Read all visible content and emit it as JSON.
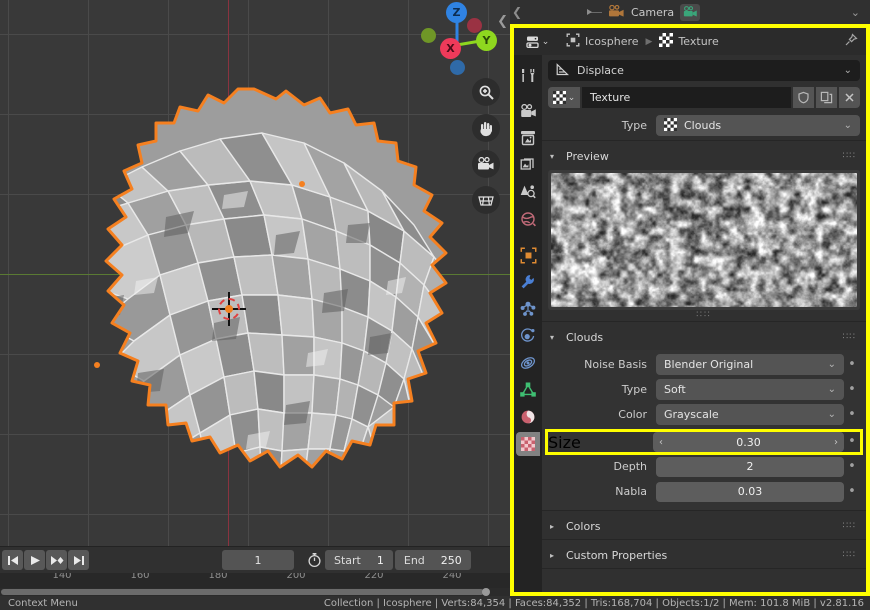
{
  "outliner": {
    "back_icon": "chevron-left-icon",
    "camera_label": "Camera",
    "camera_icon": "camera-icon",
    "camera_data_icon": "camera-data-icon",
    "collapse_icon": "chevron-down-icon"
  },
  "viewport": {
    "gizmo": {
      "x_label": "X",
      "y_label": "Y",
      "z_label": "Z",
      "x_color": "#ee3a5a",
      "y_color": "#8ed71f",
      "z_color": "#2f83e3"
    },
    "tools": [
      {
        "name": "zoom-icon",
        "title": "Zoom"
      },
      {
        "name": "hand-icon",
        "title": "Move View"
      },
      {
        "name": "camera-icon",
        "title": "Camera View"
      },
      {
        "name": "grid-icon",
        "title": "Toggle Orthographic"
      }
    ],
    "selection_outline_color": "#f58020",
    "background_color": "#393939",
    "cursor_icon": "3d-cursor-icon"
  },
  "timeline": {
    "playback": [
      {
        "name": "jump-start-button",
        "glyph": "◀❘"
      },
      {
        "name": "play-button",
        "glyph": "▶"
      },
      {
        "name": "next-keyframe-button",
        "glyph": "▶◆"
      },
      {
        "name": "jump-end-button",
        "glyph": "❘▶"
      }
    ],
    "current_frame": "1",
    "clock_icon": "stopwatch-icon",
    "start_label": "Start",
    "start_value": "1",
    "end_label": "End",
    "end_value": "250",
    "ruler_ticks": [
      "140",
      "160",
      "180",
      "200",
      "220",
      "240"
    ]
  },
  "properties": {
    "editor_type_icon": "properties-editor-icon",
    "breadcrumb": [
      {
        "icon": "object-icon",
        "label": "Icosphere"
      },
      {
        "icon": "texture-icon",
        "label": "Texture"
      }
    ],
    "pin_icon": "pin-icon",
    "tabs": [
      {
        "name": "tab-tool",
        "icon": "tool-icon",
        "active": false
      },
      {
        "name": "tab-render",
        "icon": "render-camera-icon",
        "active": false
      },
      {
        "name": "tab-output",
        "icon": "printer-icon",
        "active": false
      },
      {
        "name": "tab-view-layer",
        "icon": "images-icon",
        "active": false
      },
      {
        "name": "tab-scene",
        "icon": "scene-cone-icon",
        "active": false
      },
      {
        "name": "tab-world",
        "icon": "world-globe-icon",
        "active": false
      },
      {
        "name": "tab-object",
        "icon": "object-square-icon",
        "active": false
      },
      {
        "name": "tab-modifiers",
        "icon": "wrench-icon",
        "active": false
      },
      {
        "name": "tab-particles",
        "icon": "particles-icon",
        "active": false
      },
      {
        "name": "tab-physics",
        "icon": "physics-orbit-icon",
        "active": false
      },
      {
        "name": "tab-constraints",
        "icon": "constraint-icon",
        "active": false
      },
      {
        "name": "tab-data",
        "icon": "mesh-data-icon",
        "active": false
      },
      {
        "name": "tab-material",
        "icon": "material-sphere-icon",
        "active": false
      },
      {
        "name": "tab-texture",
        "icon": "texture-checker-icon",
        "active": true
      }
    ],
    "modifier_context": {
      "icon": "displace-modifier-icon",
      "label": "Displace",
      "chevron": "⌄"
    },
    "datablock": {
      "type_icon": "texture-checker-icon",
      "dropdown_glyph": "⌄",
      "name": "Texture",
      "fake_user_icon": "shield-icon",
      "copy_icon": "copy-icon",
      "unlink_icon": "x-icon"
    },
    "type_row": {
      "label": "Type",
      "icon": "texture-checker-icon",
      "value": "Clouds",
      "chevron": "⌄"
    },
    "preview_panel": {
      "title": "Preview",
      "tri": "▾",
      "grip": "∷∷"
    },
    "clouds_panel": {
      "title": "Clouds",
      "tri": "▾",
      "grip": "∷∷",
      "fields": [
        {
          "label": "Noise Basis",
          "value": "Blender Original",
          "kind": "select",
          "name": "noise-basis-select"
        },
        {
          "label": "Type",
          "value": "Soft",
          "kind": "select",
          "name": "clouds-type-select"
        },
        {
          "label": "Color",
          "value": "Grayscale",
          "kind": "select",
          "name": "color-select"
        }
      ],
      "size_field": {
        "label": "Size",
        "value": "0.30",
        "left_arrow": "‹",
        "right_arrow": "›",
        "name": "size-slider",
        "highlight_color": "#ffff00"
      },
      "numeric_fields": [
        {
          "label": "Depth",
          "value": "2",
          "name": "depth-field"
        },
        {
          "label": "Nabla",
          "value": "0.03",
          "name": "nabla-field"
        }
      ],
      "anim_dot": "•"
    },
    "closed_panels": [
      {
        "title": "Colors",
        "tri": "▸",
        "grip": "∷∷",
        "name": "panel-colors"
      },
      {
        "title": "Custom Properties",
        "tri": "▸",
        "grip": "∷∷",
        "name": "panel-custom-properties"
      }
    ]
  },
  "status_bar": {
    "context_menu": "Context Menu",
    "stats": "Collection | Icosphere | Verts:84,354 | Faces:84,352 | Tris:168,704 | Objects:1/2 | Mem: 101.8 MiB | v2.81.16"
  }
}
